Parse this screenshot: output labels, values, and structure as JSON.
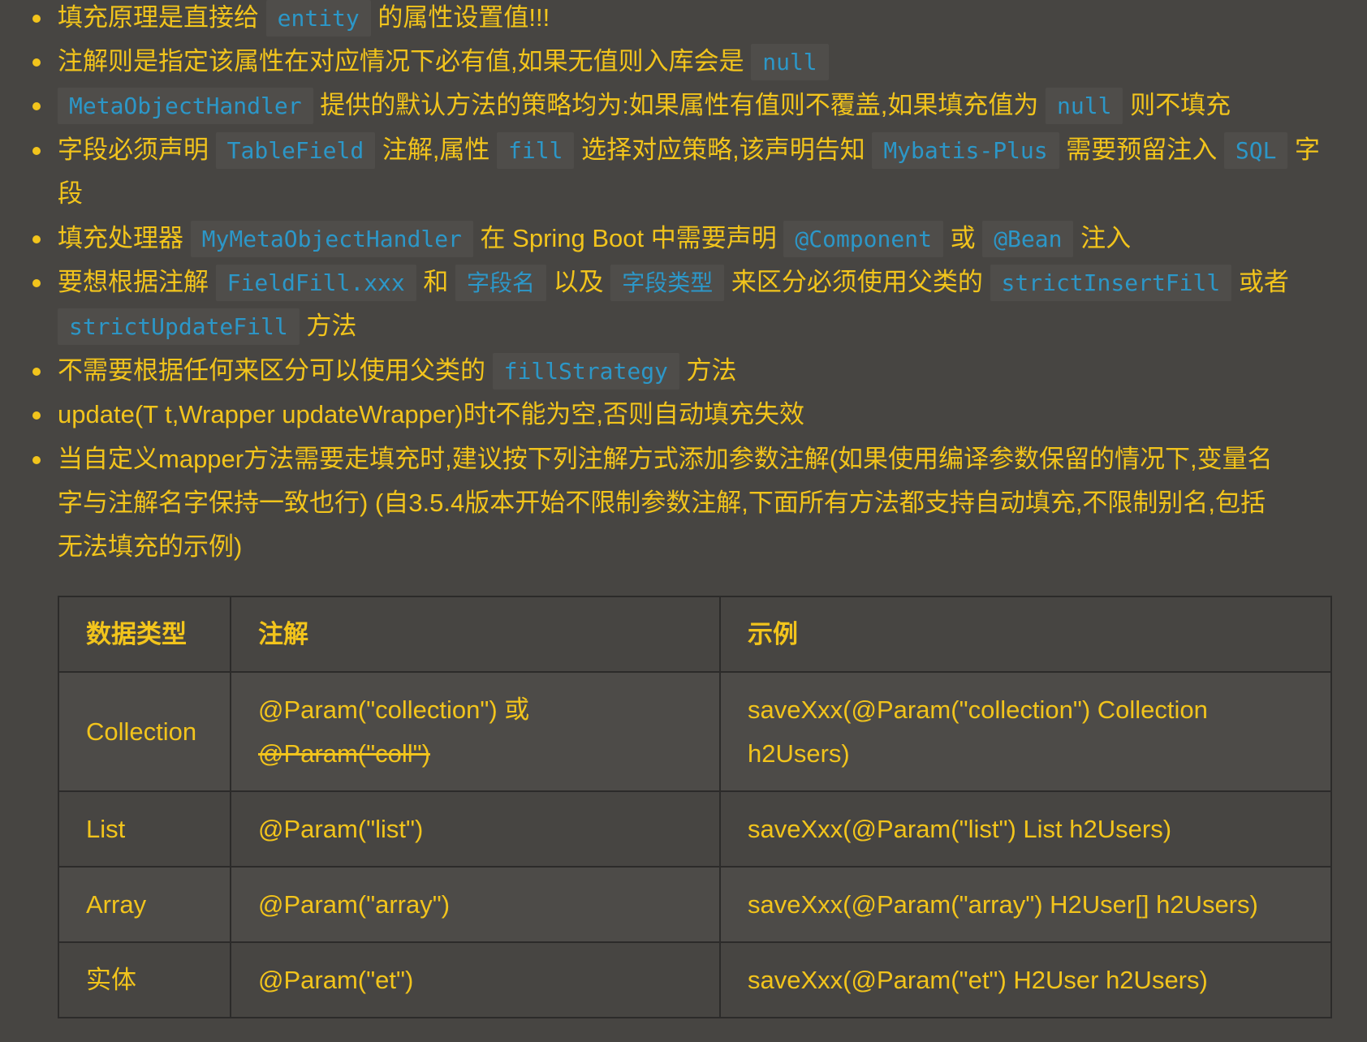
{
  "notes": [
    {
      "parts": [
        "填充原理是直接给 ",
        "entity",
        " 的属性设置值!!!"
      ]
    },
    {
      "parts": [
        "注解则是指定该属性在对应情况下必有值,如果无值则入库会是 ",
        "null"
      ]
    },
    {
      "parts": [
        "MetaObjectHandler",
        " 提供的默认方法的策略均为:如果属性有值则不覆盖,如果填充值为 ",
        "null",
        " 则不填充"
      ]
    },
    {
      "line1": [
        "字段必须声明 ",
        "TableField",
        " 注解,属性 ",
        "fill",
        " 选择对应策略,该声明告知 ",
        "Mybatis-Plus",
        " 需要预留注入 ",
        "SQL",
        " 字"
      ],
      "line2": "段"
    },
    {
      "parts": [
        "填充处理器 ",
        "MyMetaObjectHandler",
        " 在 Spring Boot 中需要声明 ",
        "@Component",
        " 或 ",
        "@Bean",
        " 注入"
      ]
    },
    {
      "line1": [
        "要想根据注解 ",
        "FieldFill.xxx",
        " 和 ",
        "字段名",
        " 以及 ",
        "字段类型",
        " 来区分必须使用父类的 ",
        "strictInsertFill",
        " 或者"
      ],
      "line2": [
        "strictUpdateFill",
        " 方法"
      ]
    },
    {
      "parts": [
        "不需要根据任何来区分可以使用父类的 ",
        "fillStrategy",
        " 方法"
      ]
    },
    {
      "text": "update(T t,Wrapper updateWrapper)时t不能为空,否则自动填充失效"
    },
    {
      "lines": [
        "当自定义mapper方法需要走填充时,建议按下列注解方式添加参数注解(如果使用编译参数保留的情况下,变量名",
        "字与注解名字保持一致也行) (自3.5.4版本开始不限制参数注解,下面所有方法都支持自动填充,不限制别名,包括",
        "无法填充的示例)"
      ]
    }
  ],
  "table": {
    "headers": [
      "数据类型",
      "注解",
      "示例"
    ],
    "rows": [
      {
        "type": "Collection",
        "annotation": "@Param(\"collection\") 或",
        "annotation_struck": "@Param(\"coll\")",
        "example_line1": "saveXxx(@Param(\"collection\") Collection",
        "example_line2": "h2Users)"
      },
      {
        "type": "List",
        "annotation": "@Param(\"list\")",
        "example": "saveXxx(@Param(\"list\") List h2Users)"
      },
      {
        "type": "Array",
        "annotation": "@Param(\"array\")",
        "example": "saveXxx(@Param(\"array\") H2User[] h2Users)"
      },
      {
        "type": "实体",
        "annotation": "@Param(\"et\")",
        "example": "saveXxx(@Param(\"et\") H2User h2Users)"
      }
    ]
  }
}
